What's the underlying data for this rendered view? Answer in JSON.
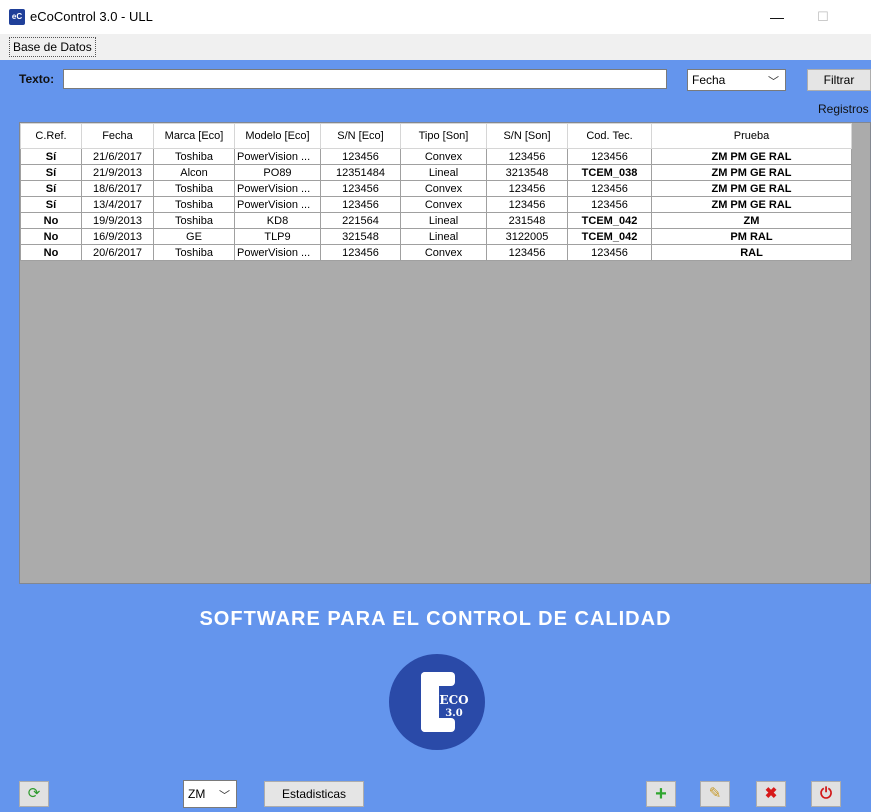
{
  "window": {
    "title": "eCoControl 3.0 - ULL",
    "icon_text": "eC",
    "minimize_glyph": "—",
    "maximize_glyph": "☐"
  },
  "menu": {
    "items": [
      "Base de Datos"
    ]
  },
  "filter": {
    "label": "Texto:",
    "text_value": "",
    "field_selected": "Fecha",
    "filter_button": "Filtrar",
    "records_label": "Registros"
  },
  "table": {
    "columns": [
      "C.Ref.",
      "Fecha",
      "Marca [Eco]",
      "Modelo [Eco]",
      "S/N [Eco]",
      "Tipo [Son]",
      "S/N [Son]",
      "Cod. Tec.",
      "Prueba"
    ],
    "rows": [
      [
        "Sí",
        "21/6/2017",
        "Toshiba",
        "PowerVision ...",
        "123456",
        "Convex",
        "123456",
        "123456",
        "ZM PM GE RAL"
      ],
      [
        "Sí",
        "21/9/2013",
        "Alcon",
        "PO89",
        "12351484",
        "Lineal",
        "3213548",
        "TCEM_038",
        "ZM PM GE RAL"
      ],
      [
        "Sí",
        "18/6/2017",
        "Toshiba",
        "PowerVision ...",
        "123456",
        "Convex",
        "123456",
        "123456",
        "ZM PM GE RAL"
      ],
      [
        "Sí",
        "13/4/2017",
        "Toshiba",
        "PowerVision ...",
        "123456",
        "Convex",
        "123456",
        "123456",
        "ZM PM GE RAL"
      ],
      [
        "No",
        "19/9/2013",
        "Toshiba",
        "KD8",
        "221564",
        "Lineal",
        "231548",
        "TCEM_042",
        "ZM"
      ],
      [
        "No",
        "16/9/2013",
        "GE",
        "TLP9",
        "321548",
        "Lineal",
        "3122005",
        "TCEM_042",
        "PM RAL"
      ],
      [
        "No",
        "20/6/2017",
        "Toshiba",
        "PowerVision ...",
        "123456",
        "Convex",
        "123456",
        "123456",
        "RAL"
      ]
    ]
  },
  "banner": {
    "text": "SOFTWARE PARA EL CONTROL DE CALIDAD"
  },
  "logo": {
    "line1": "ECO",
    "line2": "3.0"
  },
  "bottom": {
    "test_selected": "ZM",
    "stats_button": "Estadisticas",
    "icons": [
      "refresh-icon",
      "add-icon",
      "edit-icon",
      "delete-icon",
      "power-icon"
    ]
  },
  "colors": {
    "background": "#6495ed",
    "logo_blue": "#2a4aa8",
    "add": "#2fa52f",
    "delete": "#d71a1a",
    "power": "#d21919"
  }
}
